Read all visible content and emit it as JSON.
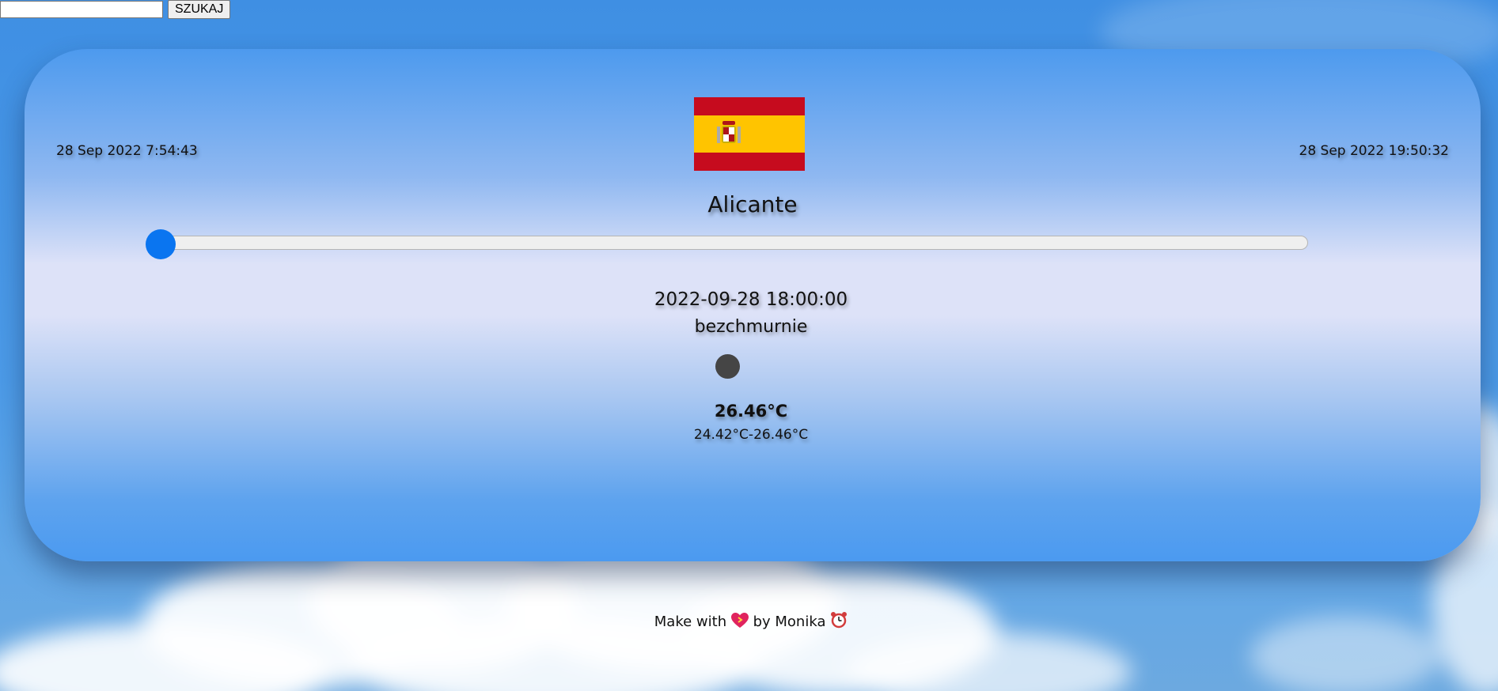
{
  "search": {
    "value": "",
    "button_label": "SZUKAJ"
  },
  "weather": {
    "sunrise": "28 Sep 2022 7:54:43",
    "sunset": "28 Sep 2022 19:50:32",
    "flag_icon": "spain-flag-icon",
    "city": "Alicante",
    "forecast_slider_position": 0,
    "forecast_datetime": "2022-09-28 18:00:00",
    "description": "bezchmurnie",
    "weather_icon": "weather-icon",
    "temperature": "26.46°C",
    "temperature_range": "24.42°C-26.46°C"
  },
  "footer": {
    "text_before": "Make with",
    "heart_icon": "heart-icon",
    "text_after": "by Monika",
    "clock_icon": "alarm-clock-icon"
  },
  "colors": {
    "slider_thumb": "#0a75f0",
    "flag_red": "#c60b1e",
    "flag_yellow": "#ffc400"
  }
}
